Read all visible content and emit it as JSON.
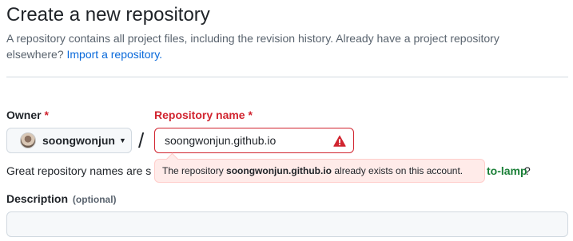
{
  "page": {
    "title": "Create a new repository",
    "subtitle_line1": "A repository contains all project files, including the revision history. Already have a project repository",
    "subtitle_line2": "elsewhere?",
    "import_link": "Import a repository."
  },
  "form": {
    "owner_label": "Owner",
    "required_mark": "*",
    "owner_value": "soongwonjun",
    "separator": "/",
    "repo_label": "Repository name",
    "repo_value": "soongwonjun.github.io",
    "hint_text": "Great repository names are s",
    "hint_suggestion": "to-lamp",
    "hint_q": "?",
    "error_prefix": "The repository",
    "error_repo": "soongwonjun.github.io",
    "error_suffix": "already exists on this account.",
    "description_label": "Description",
    "description_optional": "(optional)",
    "description_value": ""
  },
  "colors": {
    "error": "#d1242f",
    "link": "#0969da",
    "success": "#1a7f37"
  },
  "icons": {
    "owner_caret": "chevron-down-icon",
    "error": "alert-triangle-icon"
  }
}
